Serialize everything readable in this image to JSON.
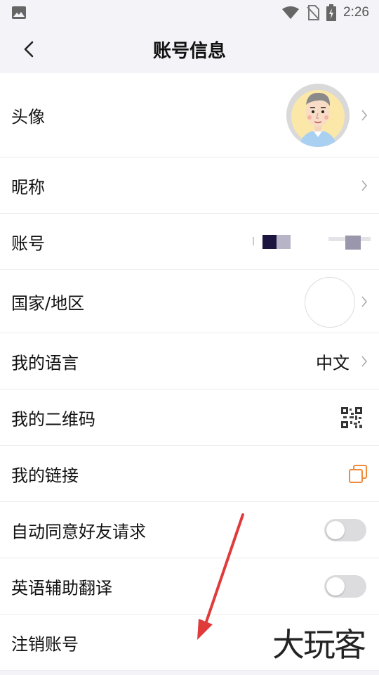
{
  "status_bar": {
    "time": "2:26"
  },
  "header": {
    "title": "账号信息"
  },
  "rows": [
    {
      "label": "头像"
    },
    {
      "label": "昵称"
    },
    {
      "label": "账号"
    },
    {
      "label": "国家/地区"
    },
    {
      "label": "我的语言",
      "value": "中文"
    },
    {
      "label": "我的二维码"
    },
    {
      "label": "我的链接"
    },
    {
      "label": "自动同意好友请求",
      "toggle": false
    },
    {
      "label": "英语辅助翻译",
      "toggle": false
    },
    {
      "label": "注销账号"
    }
  ],
  "watermark": "大玩客",
  "colors": {
    "accent_copy": "#f08a3c",
    "arrow": "#e03b3b",
    "toggle_off": "#dcdcde"
  }
}
